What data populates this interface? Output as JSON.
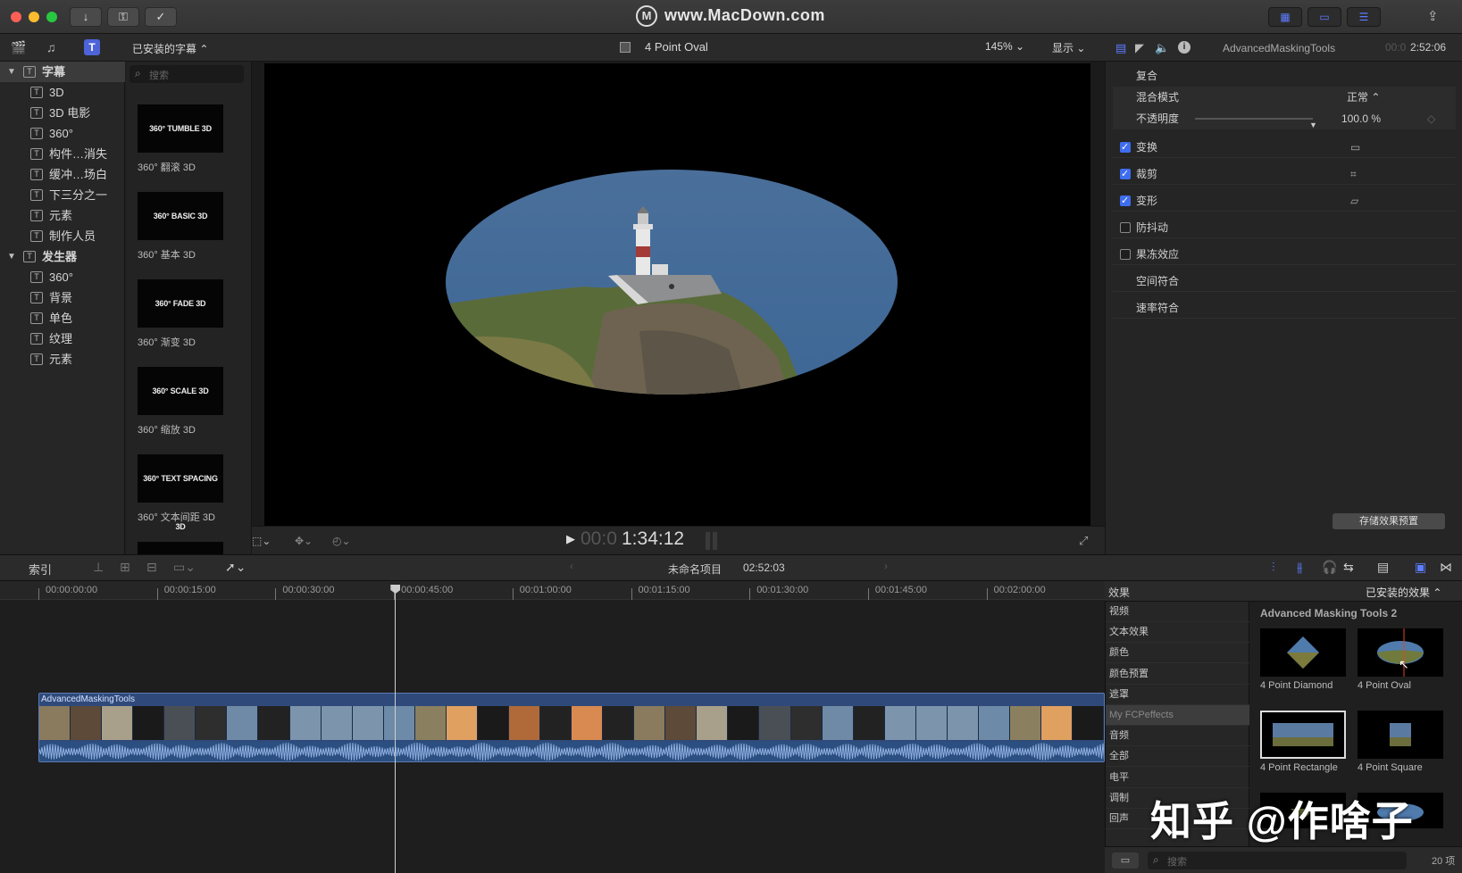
{
  "titlebar": {
    "brand": "www.MacDown.com",
    "import_icon": "↓",
    "keyword_icon": "⚿",
    "check_icon": "✓",
    "view_icons": [
      "▦",
      "▭",
      "☰"
    ],
    "share_icon": "⇪"
  },
  "library": {
    "dropdown_label": "已安装的字幕 ⌃",
    "search_placeholder": "搜索",
    "tree": [
      {
        "label": "字幕",
        "level": 0,
        "expanded": true,
        "selected": true
      },
      {
        "label": "3D",
        "level": 1
      },
      {
        "label": "3D 电影",
        "level": 1
      },
      {
        "label": "360°",
        "level": 1
      },
      {
        "label": "构件…消失",
        "level": 1
      },
      {
        "label": "缓冲…场白",
        "level": 1
      },
      {
        "label": "下三分之一",
        "level": 1
      },
      {
        "label": "元素",
        "level": 1
      },
      {
        "label": "制作人员",
        "level": 1
      },
      {
        "label": "发生器",
        "level": 0,
        "expanded": true
      },
      {
        "label": "360°",
        "level": 1
      },
      {
        "label": "背景",
        "level": 1
      },
      {
        "label": "单色",
        "level": 1
      },
      {
        "label": "纹理",
        "level": 1
      },
      {
        "label": "元素",
        "level": 1
      }
    ],
    "thumbnails": [
      {
        "art": "360° TUMBLE 3D",
        "label": "360° 翻滚 3D"
      },
      {
        "art": "360° BASIC 3D",
        "label": "360° 基本 3D"
      },
      {
        "art": "360° FADE 3D",
        "label": "360° 渐变 3D"
      },
      {
        "art": "360° SCALE 3D",
        "label": "360° 缩放 3D"
      },
      {
        "art": "360° TEXT SPACING 3D",
        "label": "360° 文本间距 3D"
      }
    ]
  },
  "viewer": {
    "clip_name": "4 Point Oval",
    "zoom": "145% ⌄",
    "display_menu": "显示 ⌄",
    "timecode_dim": "00:0",
    "timecode": "1:34:12"
  },
  "inspector": {
    "clip_title": "AdvancedMaskingTools",
    "duration_dim": "00:0",
    "duration": "2:52:06",
    "section_composite": "复合",
    "blend_mode_label": "混合模式",
    "blend_mode_value": "正常 ⌃",
    "opacity_label": "不透明度",
    "opacity_value": "100.0 %",
    "opacity_fraction": 1.0,
    "params": [
      {
        "label": "变换",
        "checked": true,
        "has_checkbox": true
      },
      {
        "label": "裁剪",
        "checked": true,
        "has_checkbox": true
      },
      {
        "label": "变形",
        "checked": true,
        "has_checkbox": true
      },
      {
        "label": "防抖动",
        "checked": false,
        "has_checkbox": true
      },
      {
        "label": "果冻效应",
        "checked": false,
        "has_checkbox": true
      },
      {
        "label": "空间符合",
        "has_checkbox": false
      },
      {
        "label": "速率符合",
        "has_checkbox": false
      }
    ],
    "save_preset": "存储效果预置"
  },
  "timeline_toolbar": {
    "index_label": "索引",
    "project_name": "未命名项目",
    "project_duration": "02:52:03"
  },
  "timeline": {
    "ruler_labels": [
      "00:00:00:00",
      "00:00:15:00",
      "00:00:30:00",
      "00:00:45:00",
      "00:01:00:00",
      "00:01:15:00",
      "00:01:30:00",
      "00:01:45:00",
      "00:02:00:00"
    ],
    "clip_name": "AdvancedMaskingTools",
    "playhead_fraction": 0.363
  },
  "effects": {
    "header": "效果",
    "installed": "已安装的效果 ⌃",
    "categories": [
      "视频",
      "文本效果",
      "颜色",
      "颜色预置",
      "遮罩",
      "My FCPeffects",
      "音频",
      "全部",
      "电平",
      "调制",
      "回声"
    ],
    "selected_category": "My FCPeffects",
    "group_title": "Advanced Masking Tools 2",
    "items": [
      {
        "label": "4 Point Diamond"
      },
      {
        "label": "4 Point Oval"
      },
      {
        "label": "4 Point Rectangle"
      },
      {
        "label": "4 Point Square"
      }
    ],
    "search_placeholder": "搜索",
    "count": "20 项"
  },
  "watermark": "知乎 @作啥子",
  "colors": {
    "accent": "#3f6df0",
    "clip_blue": "#2f4a7a",
    "playhead": "#cccccc"
  }
}
